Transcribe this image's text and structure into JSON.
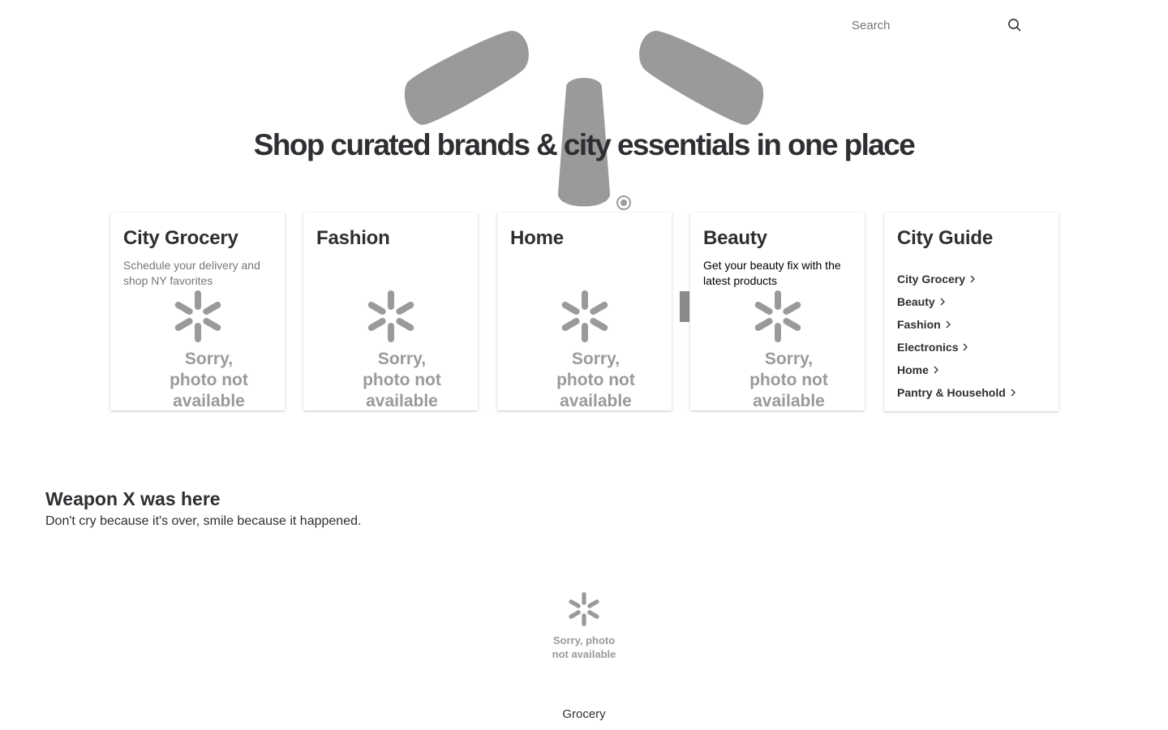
{
  "search": {
    "placeholder": "Search",
    "icon": "search-icon"
  },
  "hero": {
    "title": "Shop curated brands & city essentials in one place",
    "logo": "walmart-spark-icon",
    "logo_color": "#9a9a9a"
  },
  "cards": [
    {
      "title": "City Grocery",
      "subtitle": "Schedule your delivery and shop NY favorites",
      "placeholder": "Sorry, photo not available"
    },
    {
      "title": "Fashion",
      "subtitle": "",
      "placeholder": "Sorry, photo not available"
    },
    {
      "title": "Home",
      "subtitle": "",
      "placeholder": "Sorry, photo not available"
    },
    {
      "title": "Beauty",
      "subtitle": "Get your beauty fix with the latest products",
      "placeholder": "Sorry, photo not available"
    }
  ],
  "city_guide": {
    "title": "City Guide",
    "items": [
      "City Grocery",
      "Beauty",
      "Fashion",
      "Electronics",
      "Home",
      "Pantry & Household"
    ]
  },
  "promo": {
    "title": "Weapon X was here",
    "subtitle": "Don't cry because it's over, smile because it happened."
  },
  "bottom": {
    "placeholder": "Sorry, photo not available",
    "label": "Grocery"
  },
  "colors": {
    "text": "#2e2f32",
    "muted": "#74767c",
    "placeholder_gray": "#9a9a9a"
  }
}
